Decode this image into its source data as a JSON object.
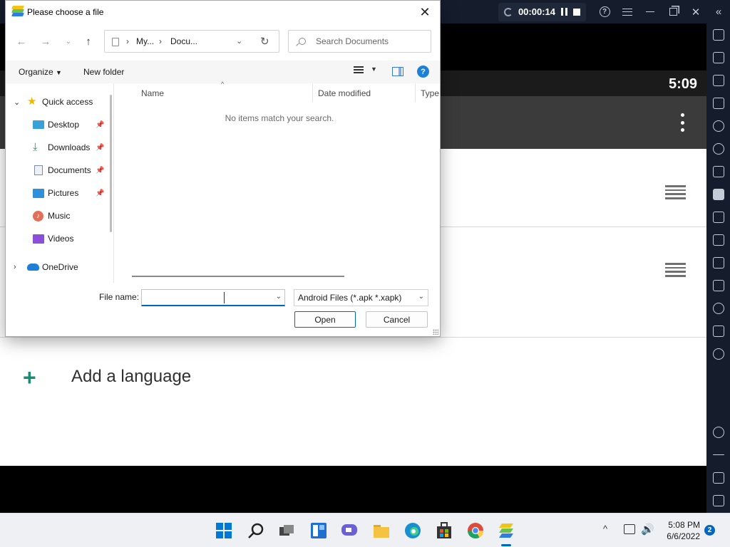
{
  "emulator": {
    "recording_time": "00:00:14",
    "android_clock": "5:09",
    "add_language_label": "Add a language",
    "sidebar_icons": [
      "fullscreen-icon",
      "volume-icon",
      "media-icon",
      "keyboard-icon",
      "replay-icon",
      "rotate-icon",
      "controller-icon",
      "apk-icon",
      "screenshot-icon",
      "folder-icon",
      "multi-instance-icon",
      "eraser-icon",
      "location-icon",
      "layers-icon",
      "speed-icon",
      "settings-icon",
      "back-icon",
      "home-icon",
      "recents-icon"
    ]
  },
  "dialog": {
    "title": "Please choose a file",
    "breadcrumbs": [
      "My...",
      "Docu..."
    ],
    "search_placeholder": "Search Documents",
    "organize_label": "Organize",
    "new_folder_label": "New folder",
    "nav_items": [
      {
        "label": "Quick access",
        "icon": "star-icon"
      },
      {
        "label": "Desktop",
        "icon": "desktop-icon",
        "pinned": true
      },
      {
        "label": "Downloads",
        "icon": "download-icon",
        "pinned": true
      },
      {
        "label": "Documents",
        "icon": "document-icon",
        "pinned": true
      },
      {
        "label": "Pictures",
        "icon": "picture-icon",
        "pinned": true
      },
      {
        "label": "Music",
        "icon": "music-icon"
      },
      {
        "label": "Videos",
        "icon": "video-icon"
      },
      {
        "label": "OneDrive",
        "icon": "cloud-icon"
      }
    ],
    "columns": [
      "Name",
      "Date modified",
      "Type"
    ],
    "empty_message": "No items match your search.",
    "file_name_label": "File name:",
    "file_name_value": "",
    "file_type_filter": "Android Files (*.apk *.xapk)",
    "open_label": "Open",
    "cancel_label": "Cancel"
  },
  "taskbar": {
    "time": "5:08 PM",
    "date": "6/6/2022",
    "notification_count": "2"
  },
  "colors": {
    "emulator_chrome": "#151c2c",
    "accent": "#0067c0",
    "android_teal": "#1e8a74"
  }
}
